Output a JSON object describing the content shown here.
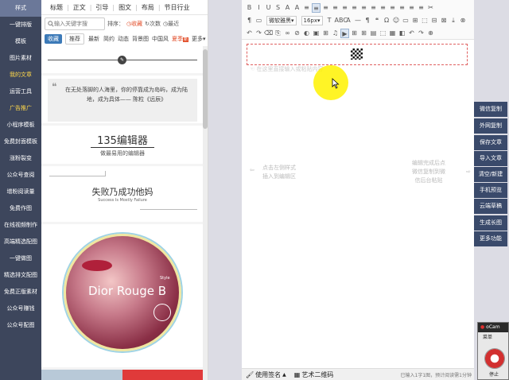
{
  "left_nav": {
    "items": [
      {
        "label": "样式",
        "active": true
      },
      {
        "label": "一键排版"
      },
      {
        "label": "模板"
      },
      {
        "label": "图片素材"
      },
      {
        "label": "我的文章"
      },
      {
        "label": "运营工具"
      },
      {
        "label": "广告推广"
      },
      {
        "label": "小程序模板"
      },
      {
        "label": "免费封面模板"
      },
      {
        "label": "涨粉裂变"
      },
      {
        "label": "公众号查阅"
      },
      {
        "label": "增粉阅读量"
      },
      {
        "label": "免费作图"
      },
      {
        "label": "在线视频制作"
      },
      {
        "label": "高端精选配图"
      },
      {
        "label": "一键做图"
      },
      {
        "label": "精选排文配图"
      },
      {
        "label": "免费正版素材"
      },
      {
        "label": "公众号赚钱"
      },
      {
        "label": "公众号配图"
      }
    ]
  },
  "category_tabs": [
    "标题",
    "正文",
    "引导",
    "图文",
    "布局",
    "节日行业"
  ],
  "search": {
    "placeholder": "输入关键字搜"
  },
  "sort": {
    "label": "排序：",
    "options": [
      "收藏",
      "次数",
      "最近"
    ]
  },
  "filters": [
    "收藏",
    "推荐",
    "最新",
    "简约",
    "动态",
    "背景图",
    "中国风",
    "夏季",
    "更多"
  ],
  "templates": {
    "quote_text": "在无处落脚的人海里，你的停靠成为岛屿，成为陆地，成为具体—— 陈粒《远辰》",
    "brand_title": "135编辑器",
    "brand_sub": "做最易用的编辑器",
    "failure_title": "失败乃成功他妈",
    "failure_sub": "Success Is Mostly Failure",
    "dior_title": "Dior Rouge B",
    "dior_small": "Style"
  },
  "toolbar": {
    "font_family": "微软雅黑",
    "font_size": "16px",
    "row1": [
      "B",
      "I",
      "U",
      "S",
      "A",
      "A",
      "≡",
      "≡",
      "≡",
      "≡",
      "≡",
      "≡",
      "≡",
      "≡",
      "≡",
      "≡",
      "≡",
      "≡",
      "≡",
      "✂"
    ],
    "row2": [
      "¶",
      "Aa",
      "T",
      "ABC",
      "A",
      "—",
      "¶",
      "❝",
      "Ω",
      "☺",
      "▭",
      "⊞",
      "⬚",
      "⊟",
      "⊠",
      "⤓",
      "⊗"
    ],
    "row3": [
      "↶",
      "↷",
      "⌫",
      "⎘",
      "∞",
      "⊘",
      "◐",
      "▣",
      "⊞",
      "♫",
      "▶",
      "⊞",
      "⊞",
      "▤",
      "⬚",
      "▦",
      "◧",
      "↶",
      "↷",
      "⊕"
    ]
  },
  "editor": {
    "placeholder_top": "在这里直接输入或粘贴内容",
    "hint_left_1": "点击左侧样式",
    "hint_left_2": "插入到编辑区",
    "hint_right_1": "编辑完成后点",
    "hint_right_2": "微信复制到微",
    "hint_right_3": "信后台粘贴"
  },
  "statusbar": {
    "signature": "使用签名",
    "qrcode": "艺术二维码",
    "info": "已输入1字1图，预计阅读需1分钟"
  },
  "right_buttons": [
    "微信复制",
    "外网复制",
    "保存文章",
    "导入文章",
    "清空/新建",
    "手机预览",
    "云端草稿",
    "生成长图",
    "更多功能"
  ],
  "ocam": {
    "title": "oCam",
    "menu": "菜单",
    "stop": "停止"
  },
  "colors": {
    "nav_bg": "#3d465c",
    "nav_active": "#6b7899",
    "accent_red": "#e24f2b",
    "right_btn": "#3a4a6b",
    "cursor_highlight": "#fff200"
  }
}
